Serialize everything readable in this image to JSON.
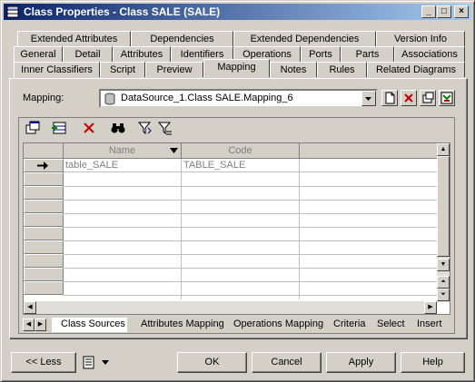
{
  "window": {
    "title": "Class Properties - Class SALE (SALE)"
  },
  "title_buttons": {
    "minimize": "_",
    "maximize": "□",
    "close": "×"
  },
  "tabs": {
    "row1": [
      "Extended Attributes",
      "Dependencies",
      "Extended Dependencies",
      "Version Info"
    ],
    "row2": [
      "General",
      "Detail",
      "Attributes",
      "Identifiers",
      "Operations",
      "Ports",
      "Parts",
      "Associations"
    ],
    "row3": [
      "Inner Classifiers",
      "Script",
      "Preview",
      "Mapping",
      "Notes",
      "Rules",
      "Related Diagrams"
    ],
    "selected": "Mapping"
  },
  "mapping": {
    "label": "Mapping:",
    "value": "DataSource_1.Class SALE.Mapping_6"
  },
  "grid": {
    "columns": [
      "Name",
      "Code"
    ],
    "rows": [
      {
        "name": "table_SALE",
        "code": "TABLE_SALE"
      }
    ]
  },
  "bottom_tabs": [
    "Class Sources",
    "Attributes Mapping",
    "Operations Mapping",
    "Criteria",
    "Select",
    "Insert"
  ],
  "buttons": {
    "less": "<< Less",
    "ok": "OK",
    "cancel": "Cancel",
    "apply": "Apply",
    "help": "Help"
  },
  "colors": {
    "title_start": "#0a246a",
    "title_end": "#a6caf0",
    "face": "#d4d0c8",
    "delete_red": "#c00000"
  }
}
